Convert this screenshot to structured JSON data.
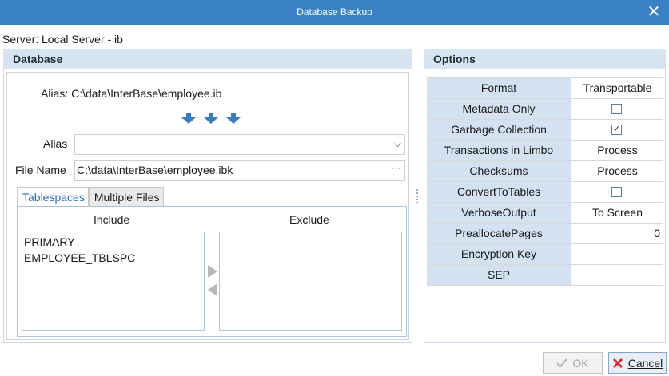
{
  "window": {
    "title": "Database Backup",
    "close_icon": "close-icon"
  },
  "server": {
    "text": "Server: Local Server - ib"
  },
  "database": {
    "heading": "Database",
    "alias_info": "Alias: C:\\data\\InterBase\\employee.ib",
    "alias_label": "Alias",
    "alias_value": "",
    "file_label": "File Name",
    "file_value": "C:\\data\\InterBase\\employee.ibk",
    "file_browse": "···",
    "combo_chevron": "⌵",
    "tabs": [
      {
        "label": "Tablespaces",
        "active": true
      },
      {
        "label": "Multiple Files",
        "active": false
      }
    ],
    "include_label": "Include",
    "exclude_label": "Exclude",
    "include_items": [
      "PRIMARY",
      "EMPLOYEE_TBLSPC"
    ],
    "exclude_items": []
  },
  "options": {
    "heading": "Options",
    "rows": [
      {
        "name": "Format",
        "value": "Transportable"
      },
      {
        "name": "Metadata Only",
        "checked": false
      },
      {
        "name": "Garbage Collection",
        "checked": true
      },
      {
        "name": "Transactions in Limbo",
        "value": "Process"
      },
      {
        "name": "Checksums",
        "value": "Process"
      },
      {
        "name": "ConvertToTables",
        "checked": false
      },
      {
        "name": "VerboseOutput",
        "value": "To Screen"
      },
      {
        "name": "PreallocatePages",
        "value": "0"
      },
      {
        "name": "Encryption Key",
        "value": ""
      },
      {
        "name": "SEP",
        "value": ""
      }
    ]
  },
  "buttons": {
    "ok": "OK",
    "cancel": "Cancel"
  },
  "colors": {
    "titlebar": "#3b82c4",
    "header": "#d6e4f2",
    "accent": "#2a70b8"
  }
}
